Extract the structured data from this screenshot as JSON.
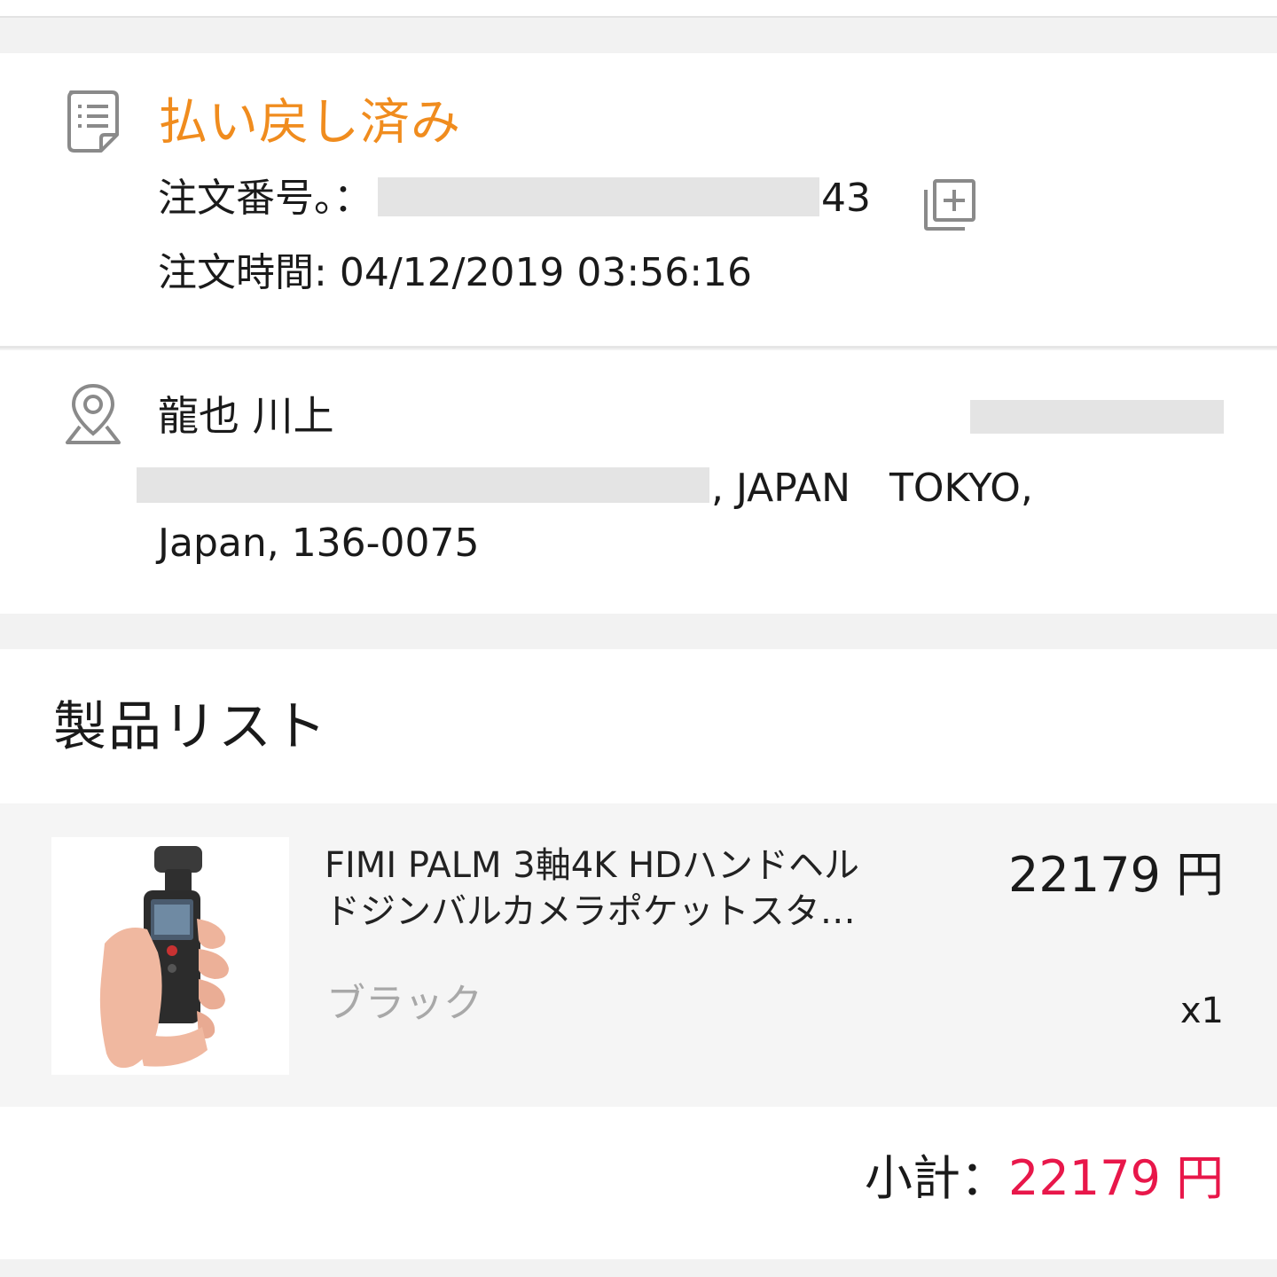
{
  "order": {
    "status": "払い戻し済み",
    "number_label": "注文番号。：",
    "number_visible_suffix": "43",
    "time_label": "注文時間:",
    "time_value": "04/12/2019 03:56:16"
  },
  "address": {
    "recipient_name": "龍也 川上",
    "line1_visible": ", JAPAN　TOKYO,",
    "line2": "Japan, 136-0075"
  },
  "products": {
    "section_title": "製品リスト",
    "items": [
      {
        "name_line1": "FIMI PALM 3軸4K HDハンドヘル",
        "name_line2": "ドジンバルカメラポケットスタ…",
        "price": "22179 円",
        "variant": "ブラック",
        "quantity": "x1"
      }
    ],
    "subtotal_label": "小計：",
    "subtotal_value": "22179 円"
  },
  "colors": {
    "status": "#f08c1e",
    "subtotal_value": "#e8174a",
    "page_background": "#f2f2f2",
    "row_background": "#f5f5f5"
  },
  "icons": {
    "order": "document-list-icon",
    "copy": "copy-plus-icon",
    "location": "location-pin-icon"
  }
}
